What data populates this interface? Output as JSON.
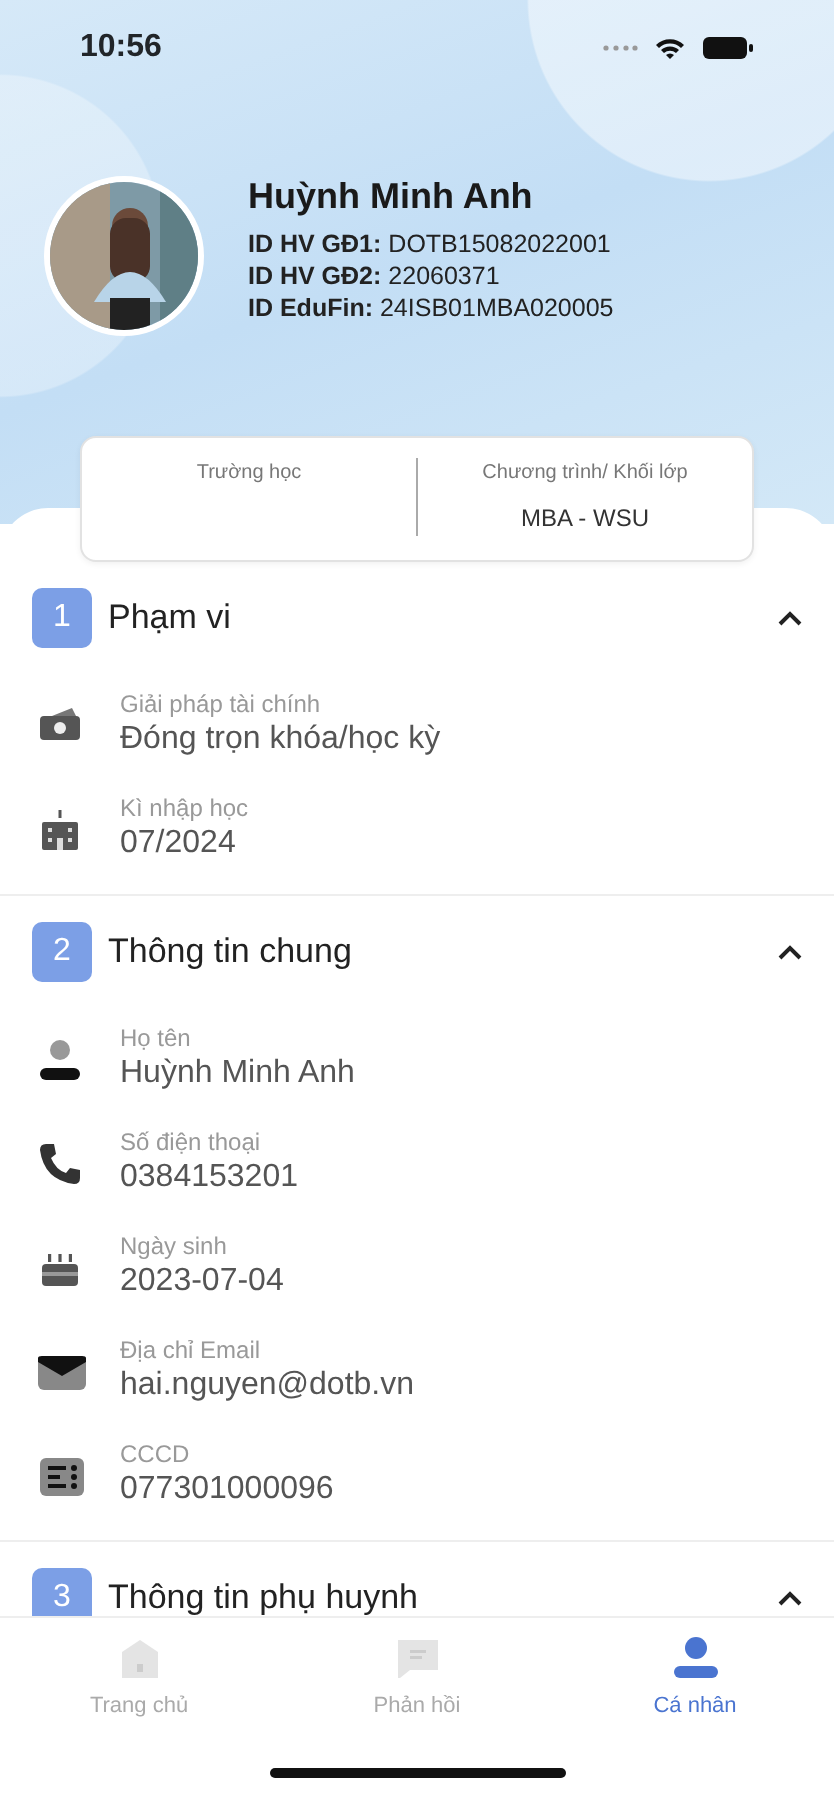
{
  "status_bar": {
    "time": "10:56"
  },
  "profile": {
    "name": "Huỳnh Minh Anh",
    "ids": [
      {
        "label": "ID HV GĐ1:",
        "value": "DOTB15082022001"
      },
      {
        "label": "ID HV GĐ2:",
        "value": "22060371"
      },
      {
        "label": "ID EduFin:",
        "value": "24ISB01MBA020005"
      }
    ]
  },
  "school_card": {
    "columns": [
      {
        "label": "Trường học"
      },
      {
        "label": "Chương trình/ Khối lớp",
        "value": "MBA - WSU"
      }
    ]
  },
  "sections": [
    {
      "number": "1",
      "title": "Phạm vi",
      "expanded": true,
      "fields": [
        {
          "kind": "money",
          "label": "Giải pháp tài chính",
          "value": "Đóng trọn khóa/học kỳ"
        },
        {
          "kind": "school",
          "label": "Kì nhập học",
          "value": "07/2024"
        }
      ]
    },
    {
      "number": "2",
      "title": "Thông tin chung",
      "expanded": true,
      "fields": [
        {
          "kind": "person",
          "label": "Họ tên",
          "value": "Huỳnh Minh Anh"
        },
        {
          "kind": "phone",
          "label": "Số điện thoại",
          "value": "0384153201"
        },
        {
          "kind": "cake",
          "label": "Ngày sinh",
          "value": "2023-07-04"
        },
        {
          "kind": "mail",
          "label": "Địa chỉ Email",
          "value": "hai.nguyen@dotb.vn"
        },
        {
          "kind": "card",
          "label": "CCCD",
          "value": "077301000096"
        }
      ]
    },
    {
      "number": "3",
      "title": "Thông tin phụ huynh",
      "expanded": true
    }
  ],
  "bottom_nav": [
    {
      "kind": "home",
      "label": "Trang chủ",
      "selected": false
    },
    {
      "kind": "chat",
      "label": "Phản hồi",
      "selected": false
    },
    {
      "kind": "person",
      "label": "Cá nhân",
      "selected": true
    }
  ]
}
